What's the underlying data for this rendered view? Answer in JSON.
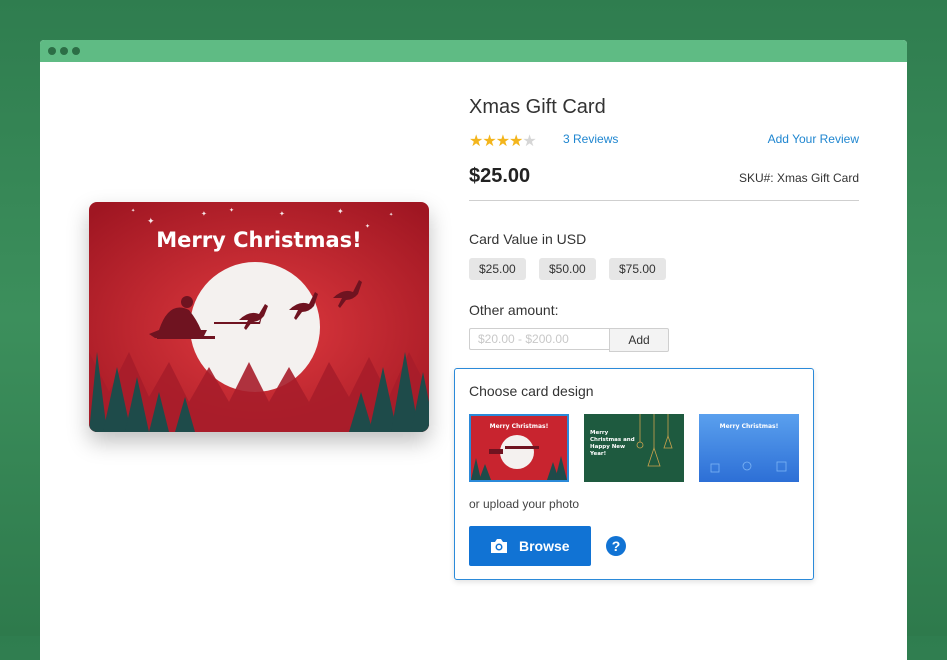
{
  "product": {
    "title": "Xmas Gift Card",
    "rating": 4,
    "rating_max": 5,
    "reviews_link": "3 Reviews",
    "add_review_link": "Add Your Review",
    "price": "$25.00",
    "sku": "SKU#: Xmas Gift Card"
  },
  "hero_card": {
    "text": "Merry Christmas!"
  },
  "card_value": {
    "label": "Card Value in USD",
    "options": [
      "$25.00",
      "$50.00",
      "$75.00"
    ]
  },
  "other_amount": {
    "label": "Other amount:",
    "placeholder": "$20.00 - $200.00",
    "add_label": "Add"
  },
  "design": {
    "title": "Choose card design",
    "thumbnails": [
      {
        "text": "Merry Christmas!",
        "selected": true
      },
      {
        "text": "Merry Christmas and Happy New Year!",
        "selected": false
      },
      {
        "text": "Merry Christmas!",
        "selected": false
      }
    ],
    "upload_text": "or upload your photo",
    "browse_label": "Browse",
    "help_symbol": "?"
  },
  "colors": {
    "background": "#2f7d4f",
    "titlebar": "#5fbb84",
    "link": "#1f86d0",
    "primary_button": "#1173d4",
    "card_red": "#c8242f"
  },
  "icons": {
    "browse": "camera-icon",
    "help": "question-icon"
  }
}
